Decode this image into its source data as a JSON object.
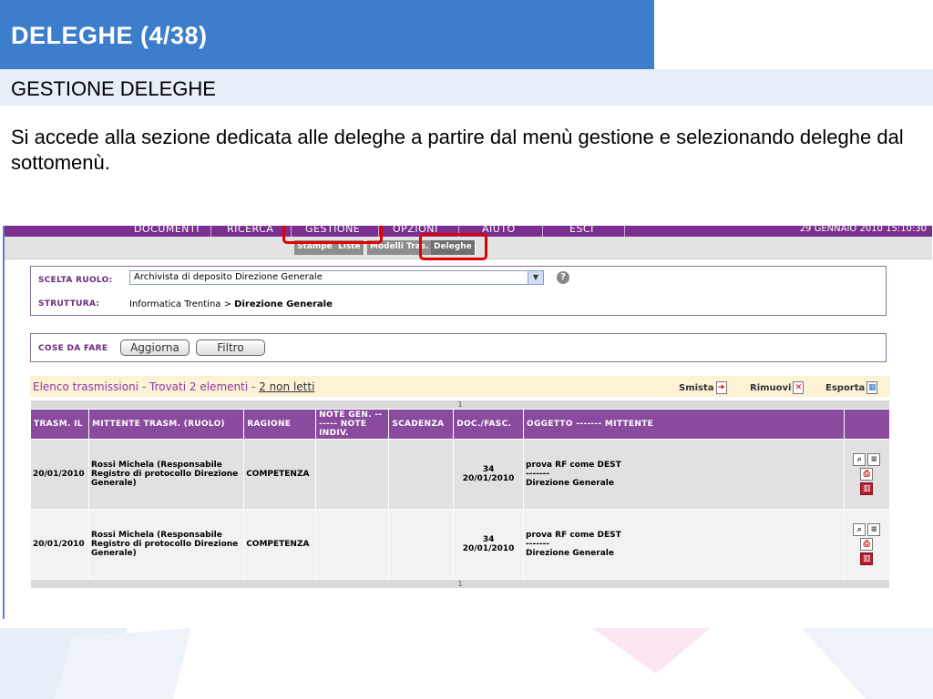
{
  "slide": {
    "title": "DELEGHE (4/38)",
    "subtitle": "GESTIONE DELEGHE",
    "body": "Si accede alla sezione dedicata alle deleghe a partire dal menù gestione e selezionando deleghe dal sottomenù."
  },
  "app": {
    "menu": [
      "DOCUMENTI",
      "RICERCA",
      "GESTIONE",
      "OPZIONI",
      "AIUTO",
      "ESCI"
    ],
    "datetime": "29 GENNAIO 2010 15:10:30",
    "submenu": [
      "Stampe",
      "Liste",
      "Modelli Tras.",
      "Deleghe"
    ],
    "role": {
      "label": "SCELTA RUOLO:",
      "value": "Archivista di deposito Direzione Generale",
      "structure_label": "STRUTTURA:",
      "structure_path": "Informatica Trentina > ",
      "structure_current": "Direzione Generale"
    },
    "todo": {
      "label": "COSE DA FARE",
      "refresh": "Aggiorna",
      "filter": "Filtro"
    },
    "list": {
      "title": "Elenco trasmissioni - Trovati 2 elementi - ",
      "unread_link": "2 non letti",
      "actions": [
        "Smista",
        "Rimuovi",
        "Esporta"
      ],
      "page": "1",
      "headers": [
        "TRASM. IL",
        "MITTENTE TRASM. (RUOLO)",
        "RAGIONE",
        "NOTE GEN. ------- NOTE INDIV.",
        "SCADENZA",
        "DOC./FASC.",
        "OGGETTO ------- MITTENTE",
        ""
      ],
      "rows": [
        {
          "date": "20/01/2010",
          "sender": "Rossi Michela (Responsabile Registro di protocollo Direzione Generale)",
          "reason": "COMPETENZA",
          "notes": "",
          "deadline": "",
          "doc_num": "34",
          "doc_date": "20/01/2010",
          "subject": "prova RF come DEST",
          "sep": "-------",
          "from": "Direzione Generale"
        },
        {
          "date": "20/01/2010",
          "sender": "Rossi Michela (Responsabile Registro di protocollo Direzione Generale)",
          "reason": "COMPETENZA",
          "notes": "",
          "deadline": "",
          "doc_num": "34",
          "doc_date": "20/01/2010",
          "subject": "prova RF come DEST",
          "sep": "-------",
          "from": "Direzione Generale"
        }
      ]
    }
  },
  "colors": {
    "title_bar": "#3c7ecb",
    "menu": "#7a2f8e",
    "highlight": "#e00000"
  }
}
